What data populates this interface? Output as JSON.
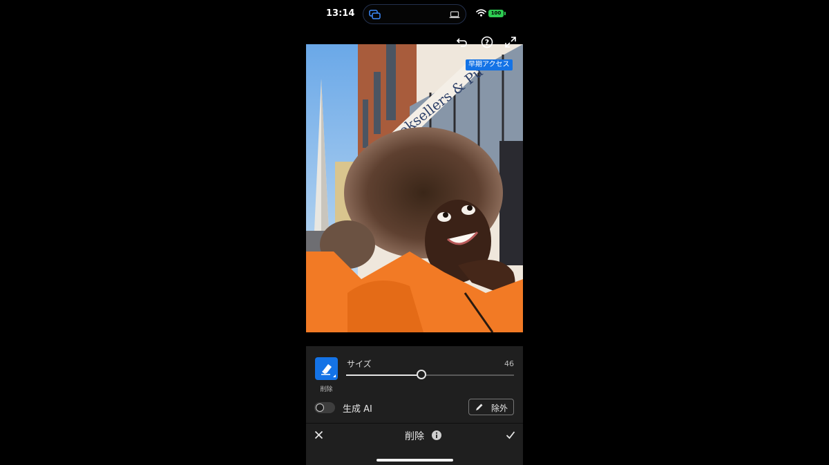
{
  "status_bar": {
    "time": "13:14",
    "battery": "100"
  },
  "photo": {
    "badge": "早期アクセス",
    "storefront_text": "Booksellers & Pu"
  },
  "toolbar_top": {
    "undo_icon": "undo-icon",
    "help_icon": "help-icon",
    "expand_icon": "expand-icon"
  },
  "panel": {
    "tool_label": "削除",
    "size_label": "サイズ",
    "size_value": "46",
    "size_fraction": 0.45,
    "gen_ai_label": "生成 AI",
    "gen_ai_enabled": false,
    "exclude_label": "除外",
    "footer_title": "削除"
  },
  "colors": {
    "accent": "#1473e6",
    "panel": "#1f1f1f",
    "battery": "#2ecc52"
  }
}
